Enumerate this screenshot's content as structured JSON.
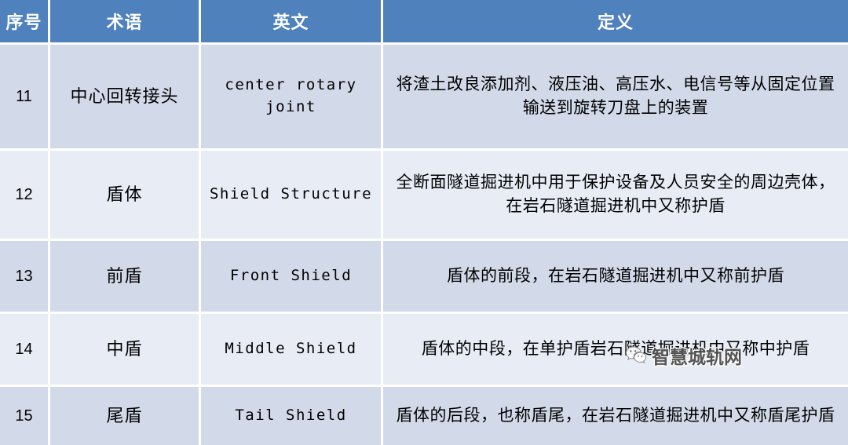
{
  "table": {
    "headers": [
      "序号",
      "术语",
      "英文",
      "定义"
    ],
    "rows": [
      {
        "no": "11",
        "term": "中心回转接头",
        "english": "center rotary joint",
        "definition": "将渣土改良添加剂、液压油、高压水、电信号等从固定位置输送到旋转刀盘上的装置"
      },
      {
        "no": "12",
        "term": "盾体",
        "english": "Shield Structure",
        "definition": "全断面隧道掘进机中用于保护设备及人员安全的周边壳体，在岩石隧道掘进机中又称护盾"
      },
      {
        "no": "13",
        "term": "前盾",
        "english": "Front Shield",
        "definition": "盾体的前段，在岩石隧道掘进机中又称前护盾"
      },
      {
        "no": "14",
        "term": "中盾",
        "english": "Middle Shield",
        "definition": "盾体的中段，在单护盾岩石隧道掘进机中又称中护盾"
      },
      {
        "no": "15",
        "term": "尾盾",
        "english": "Tail Shield",
        "definition": "盾体的后段，也称盾尾，在岩石隧道掘进机中又称盾尾护盾"
      }
    ]
  },
  "watermark": {
    "icon": "wechat-bubble-icon",
    "text": "智慧城轨网"
  },
  "colors": {
    "header_background": "#4F81BD",
    "header_text": "#FFFFFF",
    "row_shade_dark": "#D2D9E8",
    "row_shade_light": "#E7ECF5",
    "grid_line": "#FFFFFF",
    "body_text": "#000000"
  }
}
